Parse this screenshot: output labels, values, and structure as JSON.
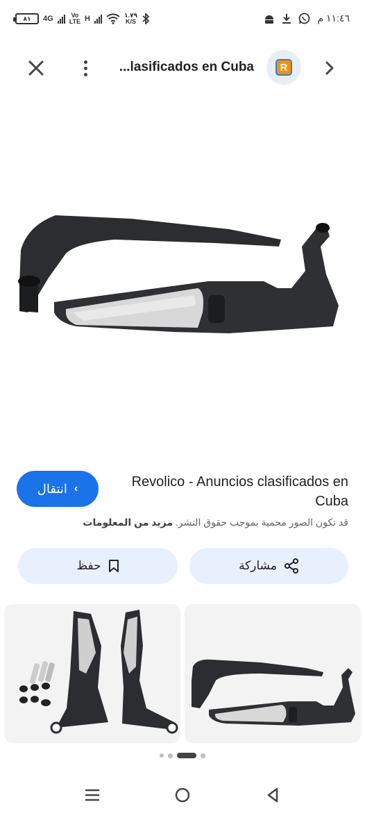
{
  "status_bar": {
    "time": "١١:٤٦ م",
    "battery_level": "٨١",
    "network_4g": "4G",
    "volte_top": "Vo",
    "volte_bottom": "LTE",
    "network_h": "H",
    "speed_value": "١.٧٩",
    "speed_unit": "K/S"
  },
  "top_bar": {
    "page_title": "...lasificados en Cuba",
    "site_logo_letter": "R"
  },
  "result": {
    "visit_label": "انتقال",
    "title": "Revolico - Anuncios clasificados en Cuba",
    "copyright_text": "قد تكون الصور محمية بموجب حقوق النشر.",
    "more_info_label": "مزيد من المعلومات"
  },
  "actions": {
    "share_label": "مشاركة",
    "save_label": "حفظ"
  },
  "colors": {
    "accent": "#1a73e8",
    "button_bg": "#e8f0fe",
    "logo_orange": "#ff8f00"
  }
}
